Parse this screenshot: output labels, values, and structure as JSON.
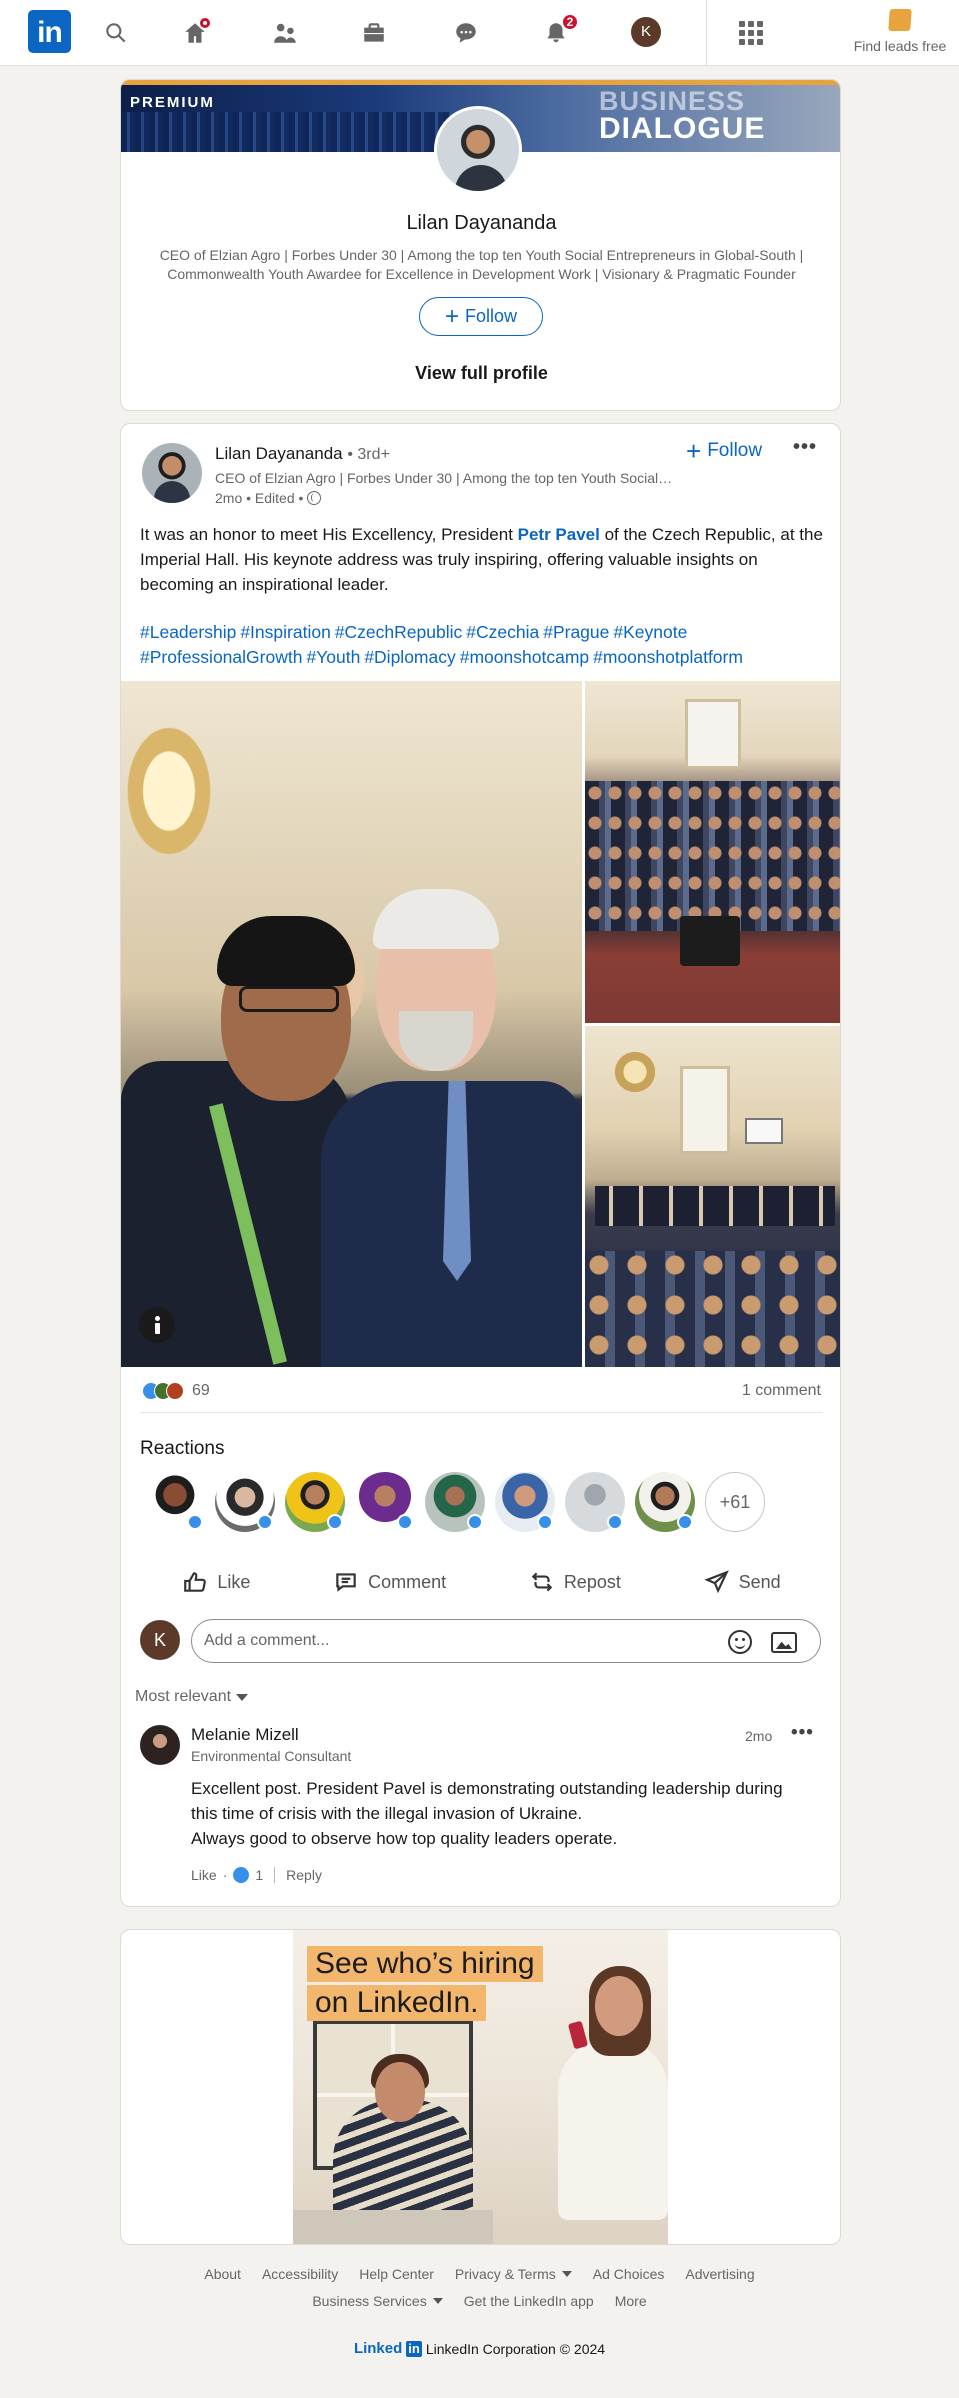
{
  "nav": {
    "logo": "in",
    "notifications_count": "2",
    "me_initial": "K",
    "premium_cta": "Find leads free"
  },
  "profile_card": {
    "banner_label": "PREMIUM",
    "banner_title_line1": "BUSINESS",
    "banner_title_line2": "DIALOGUE",
    "name": "Lilan Dayananda",
    "headline": "CEO of Elzian Agro | Forbes Under 30 | Among the top ten Youth Social Entrepreneurs in Global-South | Commonwealth Youth Awardee for Excellence in Development Work | Visionary & Pragmatic Founder",
    "follow_label": "Follow",
    "view_profile_label": "View full profile"
  },
  "post": {
    "author_name": "Lilan Dayananda",
    "author_degree": "• 3rd+",
    "author_headline": "CEO of Elzian Agro | Forbes Under 30 | Among the top ten Youth Social Entrepreneurs in Global-South",
    "time": "2mo • Edited •",
    "follow_label": "Follow",
    "more_label": "•••",
    "body_before": "It was an honor to meet His Excellency, President ",
    "mention": "Petr Pavel",
    "body_after": " of the Czech Republic, at the Imperial Hall. His keynote address was truly inspiring, offering valuable insights on becoming an inspirational leader.",
    "hashtags": [
      "#Leadership",
      "#Inspiration",
      "#CzechRepublic",
      "#Czechia",
      "#Prague",
      "#Keynote",
      "#ProfessionalGrowth",
      "#Youth",
      "#Diplomacy",
      "#moonshotcamp",
      "#moonshotplatform"
    ],
    "reaction_count": "69",
    "comment_count": "1 comment",
    "reactions_title": "Reactions",
    "more_reactors": "+61",
    "actions": {
      "like": "Like",
      "comment": "Comment",
      "repost": "Repost",
      "send": "Send"
    },
    "comment_box": {
      "avatar_initial": "K",
      "placeholder": "Add a comment..."
    },
    "sort_label": "Most relevant",
    "comment": {
      "author": "Melanie Mizell",
      "title": "Environmental Consultant",
      "time": "2mo",
      "more_label": "•••",
      "lines": [
        "Excellent post.  President Pavel is demonstrating outstanding leadership during",
        "this time of crisis with the illegal invasion of Ukraine.",
        "Always good to observe how top quality leaders operate."
      ],
      "like_label": "Like",
      "like_count": "1",
      "reply_label": "Reply"
    }
  },
  "ad": {
    "headline_line1": "See who’s hiring",
    "headline_line2": "on LinkedIn."
  },
  "footer": {
    "row1": [
      "About",
      "Accessibility",
      "Help Center",
      "Privacy & Terms",
      "Ad Choices",
      "Advertising"
    ],
    "row2": [
      "Business Services",
      "Get the LinkedIn app",
      "More"
    ],
    "brand_word": "Linked",
    "brand_box": "in",
    "copyright": "LinkedIn Corporation © 2024"
  },
  "colors": {
    "brand_blue": "#0a66c2",
    "premium_gold": "#e7a33e",
    "notification_red": "#cb112d",
    "page_background": "#f4f2ee"
  }
}
